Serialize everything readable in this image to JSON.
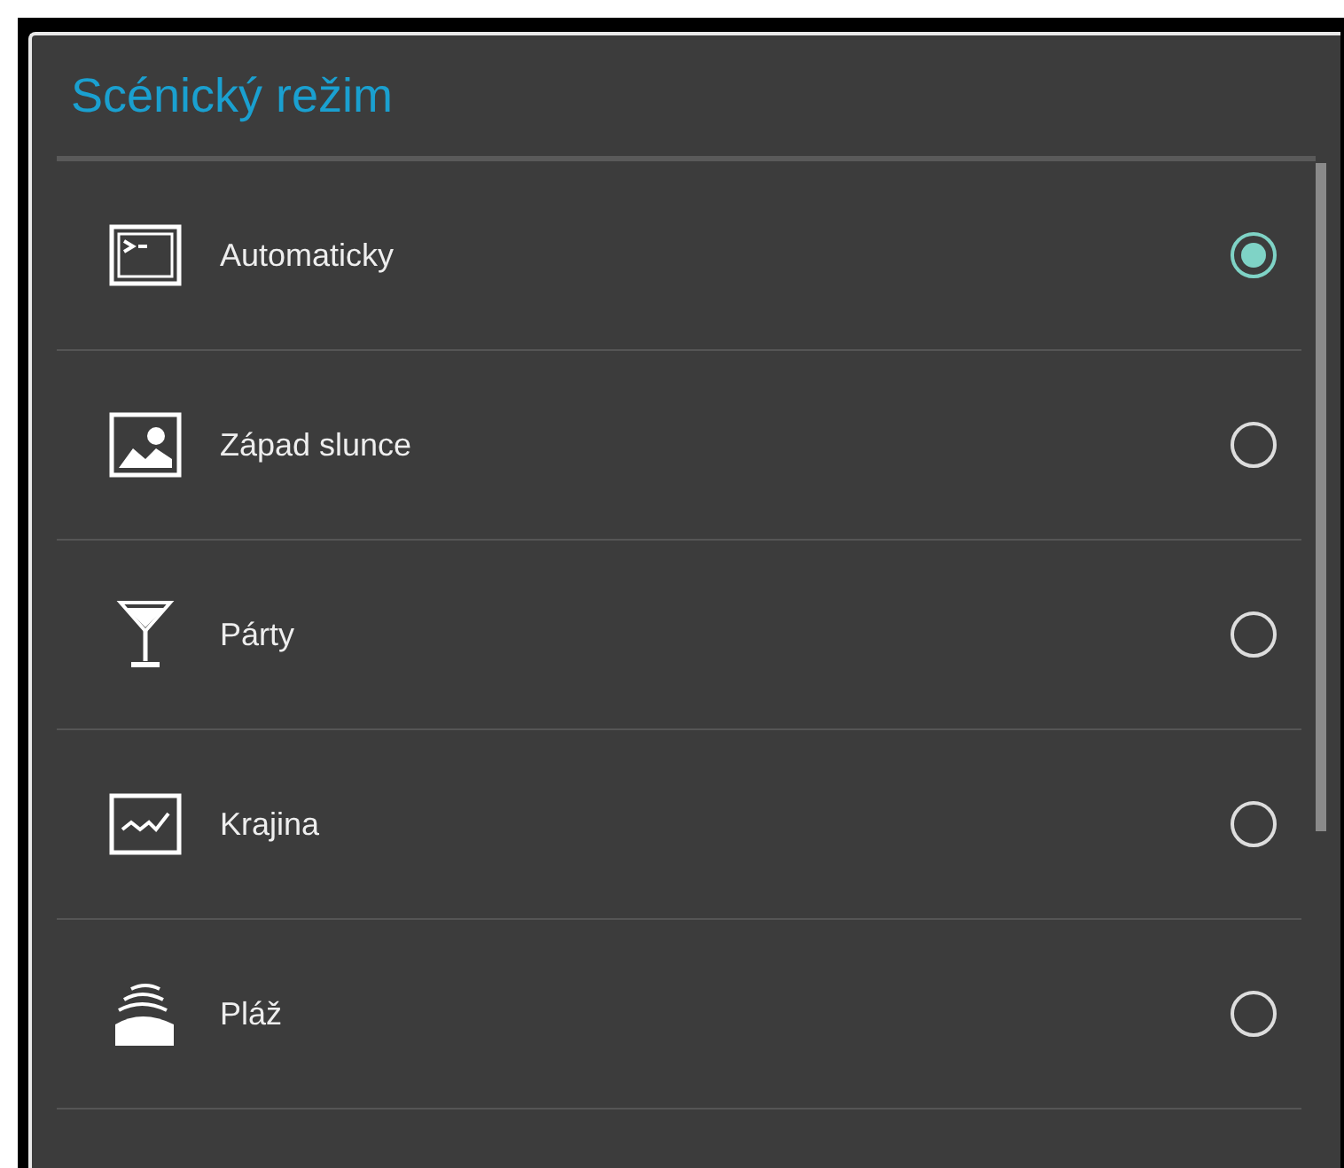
{
  "dialog": {
    "title": "Scénický režim"
  },
  "options": [
    {
      "label": "Automaticky",
      "selected": true
    },
    {
      "label": "Západ slunce",
      "selected": false
    },
    {
      "label": "Párty",
      "selected": false
    },
    {
      "label": "Krajina",
      "selected": false
    },
    {
      "label": "Pláž",
      "selected": false
    }
  ]
}
